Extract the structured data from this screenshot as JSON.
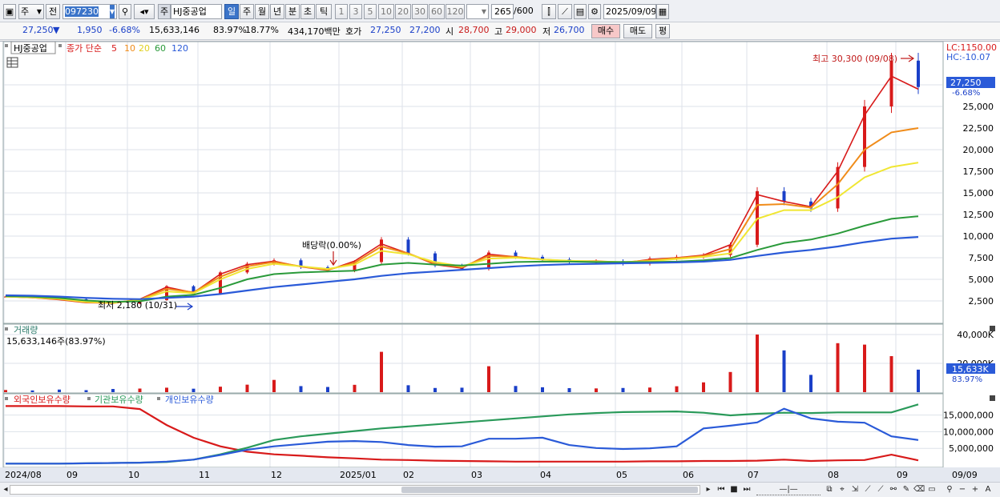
{
  "toolbar": {
    "type_select": "주",
    "prev_label": "전",
    "code": "097230",
    "stock_prefix": "주",
    "stock_name": "HJ중공업",
    "periods": [
      "일",
      "주",
      "월",
      "년",
      "분",
      "초",
      "틱"
    ],
    "period_active": "일",
    "intervals": [
      "1",
      "3",
      "5",
      "10",
      "20",
      "30",
      "60",
      "120"
    ],
    "count_value": "265",
    "count_total": "/600",
    "date": "2025/09/09"
  },
  "quote": {
    "price": "27,250",
    "direction": "▼",
    "change": "1,950",
    "change_pct": "-6.68%",
    "volume": "15,633,146",
    "vol_ratio": "83.97%",
    "turnover": "18.77%",
    "amount": "434,170백만",
    "hoga_label": "호가",
    "ask": "27,250",
    "bid": "27,200",
    "open_label": "시",
    "open": "28,700",
    "high_label": "고",
    "high": "29,000",
    "low_label": "저",
    "low": "26,700",
    "buy_label": "매수",
    "sell_label": "매도",
    "eval_label": "평"
  },
  "legend": {
    "stock": "HJ중공업",
    "price_label": "종가 단순",
    "ma_labels": [
      "5",
      "10",
      "20",
      "60",
      "120"
    ],
    "volume_label": "거래량",
    "volume_value": "15,633,146주(83.97%)",
    "holdings": [
      "외국인보유수량",
      "기관보유수량",
      "개인보유수량"
    ]
  },
  "annotations": {
    "lc": "LC:1150.00",
    "hc": "HC:-10.07",
    "max": "최고 30,300 (09/08)",
    "min": "최저 2,180 (10/31)",
    "dividend": "배당락(0.00%)",
    "price_tag": "27,250",
    "price_tag_pct": "-6.68%",
    "vol_tag": "15,633K",
    "vol_tag_pct": "83.97%"
  },
  "colors": {
    "up": "#d81a1a",
    "down": "#1a3fc8",
    "ma5": "#d81a1a",
    "ma10": "#f08c1a",
    "ma20": "#f0e632",
    "ma60": "#2a9a3a",
    "ma120": "#2a5ad8",
    "foreign": "#d81a1a",
    "institution": "#2a9a5a",
    "individual": "#2a5ad8"
  },
  "chart_data": {
    "type": "line",
    "x_labels": [
      "2024/08",
      "09",
      "10",
      "11",
      "12",
      "2025/01",
      "02",
      "03",
      "04",
      "05",
      "06",
      "07",
      "08",
      "09",
      "09/09"
    ],
    "price_axis_ticks": [
      "2,500",
      "5,000",
      "7,500",
      "10,000",
      "12,500",
      "15,000",
      "17,500",
      "20,000",
      "22,500",
      "25,000",
      "27,500"
    ],
    "volume_axis_ticks": [
      "20,000K",
      "40,000K"
    ],
    "holdings_axis_ticks": [
      "5,000,000",
      "10,000,000",
      "15,000,000"
    ],
    "price_ylim": [
      0,
      30000
    ],
    "close_series": {
      "name": "종가",
      "values": [
        3000,
        2900,
        2700,
        2300,
        2180,
        2600,
        4200,
        3300,
        5800,
        6800,
        7200,
        6400,
        6000,
        7000,
        9600,
        8000,
        6600,
        6200,
        8100,
        7600,
        7300,
        7000,
        7100,
        6800,
        7400,
        7600,
        7800,
        9000,
        15200,
        14000,
        13200,
        18000,
        25000,
        30300,
        27250
      ]
    },
    "ma_series": [
      {
        "name": "5",
        "values": [
          3000,
          2880,
          2650,
          2300,
          2250,
          2700,
          4100,
          3450,
          5600,
          6700,
          7100,
          6450,
          6050,
          7100,
          9100,
          8000,
          6700,
          6300,
          7900,
          7600,
          7300,
          7100,
          7100,
          6900,
          7300,
          7500,
          7800,
          9000,
          14800,
          14000,
          13400,
          17500,
          24000,
          28500,
          27000
        ]
      },
      {
        "name": "10",
        "values": [
          3000,
          2900,
          2700,
          2350,
          2250,
          2650,
          3900,
          3500,
          5300,
          6500,
          7000,
          6500,
          6100,
          6900,
          8800,
          8000,
          6800,
          6400,
          7700,
          7600,
          7300,
          7100,
          7100,
          6950,
          7200,
          7450,
          7700,
          8500,
          13600,
          13700,
          13300,
          16000,
          20000,
          22000,
          22500
        ]
      },
      {
        "name": "20",
        "values": [
          3000,
          2920,
          2750,
          2400,
          2300,
          2600,
          3600,
          3400,
          5000,
          6200,
          6800,
          6500,
          6200,
          6700,
          8300,
          7900,
          7000,
          6500,
          7400,
          7500,
          7300,
          7150,
          7050,
          7000,
          7100,
          7350,
          7600,
          8000,
          12000,
          13000,
          13000,
          14500,
          16800,
          18000,
          18500
        ]
      },
      {
        "name": "60",
        "values": [
          3050,
          3000,
          2850,
          2550,
          2400,
          2450,
          3000,
          3200,
          4000,
          5000,
          5600,
          5800,
          5900,
          6000,
          6700,
          6900,
          6700,
          6600,
          6800,
          7000,
          7050,
          7050,
          7000,
          7000,
          7000,
          7050,
          7200,
          7450,
          8400,
          9200,
          9600,
          10300,
          11200,
          12000,
          12300
        ]
      },
      {
        "name": "120",
        "values": [
          3150,
          3100,
          3000,
          2850,
          2750,
          2700,
          2850,
          3000,
          3300,
          3700,
          4100,
          4400,
          4700,
          5000,
          5400,
          5700,
          5900,
          6100,
          6300,
          6500,
          6650,
          6750,
          6800,
          6850,
          6900,
          6950,
          7050,
          7250,
          7700,
          8100,
          8400,
          8800,
          9300,
          9700,
          9900
        ]
      }
    ],
    "volume_series": {
      "name": "거래량",
      "unit": "K",
      "values": [
        1500,
        1200,
        1800,
        1400,
        2200,
        2500,
        3100,
        2400,
        3800,
        5200,
        8500,
        4200,
        3600,
        5100,
        28000,
        4800,
        2900,
        3100,
        18000,
        4300,
        3400,
        2800,
        2600,
        2900,
        3200,
        4100,
        6800,
        14000,
        40000,
        29000,
        12000,
        34000,
        33000,
        25000,
        15633
      ]
    },
    "holdings_series": [
      {
        "name": "외국인보유수량",
        "values": [
          17700000,
          17700000,
          17700000,
          17600000,
          17600000,
          16800000,
          12000000,
          8200000,
          5600000,
          4000000,
          3200000,
          2800000,
          2300000,
          2000000,
          1600000,
          1500000,
          1300000,
          1200000,
          1100000,
          1000000,
          1000000,
          1000000,
          1000000,
          1000000,
          1100000,
          1100000,
          1200000,
          1200000,
          1300000,
          1600000,
          1200000,
          1400000,
          1500000,
          3100000,
          1400000
        ]
      },
      {
        "name": "기관보유수량",
        "values": [
          400000,
          400000,
          400000,
          500000,
          600000,
          700000,
          900000,
          1600000,
          3200000,
          5200000,
          7500000,
          8600000,
          9400000,
          10200000,
          11000000,
          11600000,
          12200000,
          12800000,
          13400000,
          14000000,
          14600000,
          15200000,
          15600000,
          15900000,
          16000000,
          16100000,
          15700000,
          14900000,
          15400000,
          15700000,
          15600000,
          15800000,
          15800000,
          15800000,
          18200000
        ]
      },
      {
        "name": "개인보유수량",
        "values": [
          400000,
          400000,
          400000,
          500000,
          600000,
          700000,
          1000000,
          1600000,
          3000000,
          4600000,
          5600000,
          6300000,
          7000000,
          7200000,
          6900000,
          6000000,
          5500000,
          5600000,
          7900000,
          7900000,
          8200000,
          6000000,
          5100000,
          4800000,
          5000000,
          5600000,
          11000000,
          11800000,
          12800000,
          16900000,
          14000000,
          13000000,
          12700000,
          8600000,
          7500000
        ]
      }
    ]
  }
}
